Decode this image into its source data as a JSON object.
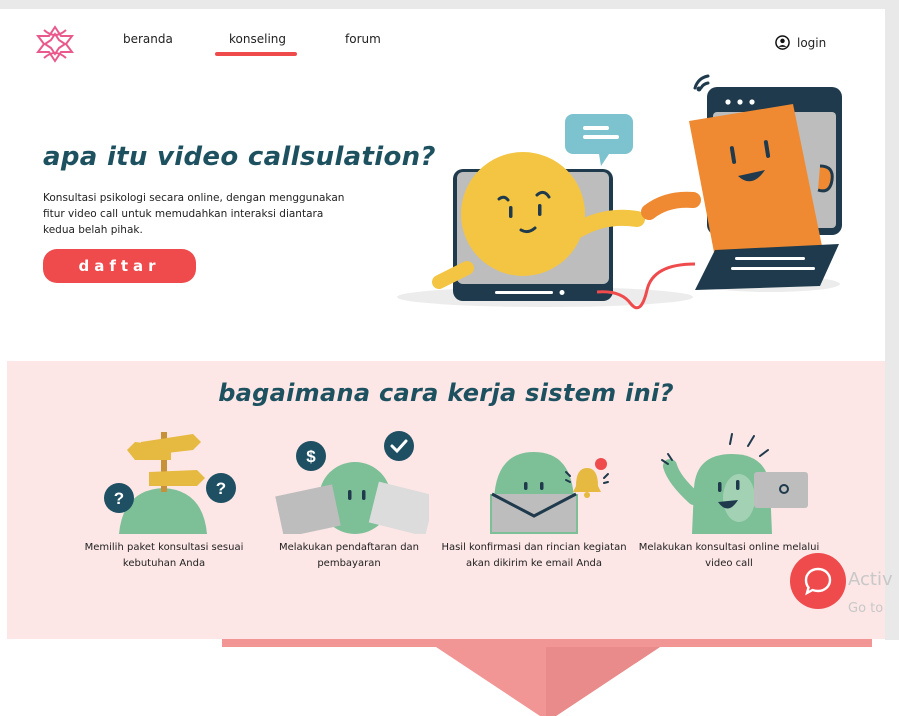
{
  "colors": {
    "brand_red": "#ef4b4d",
    "heading_teal": "#1e5160",
    "section_pink": "#fce6e6",
    "pink_logo": "#e9598c",
    "funnel_pink": "#f29595"
  },
  "header": {
    "logo_icon": "lotus-logo-icon",
    "nav": [
      {
        "label": "beranda"
      },
      {
        "label": "konseling"
      },
      {
        "label": "forum"
      }
    ],
    "active_nav": "konseling",
    "login_icon": "user-circle-icon",
    "login_label": "login"
  },
  "hero": {
    "title": "apa itu video callsulation?",
    "description": "Konsultasi psikologi secara online, dengan menggunakan fitur video call untuk memudahkan interaksi diantara kedua belah pihak.",
    "cta_label": "daftar"
  },
  "how_it_works": {
    "title": "bagaimana cara kerja sistem ini?",
    "steps": [
      {
        "text": "Memilih paket konsultasi sesuai kebutuhan Anda",
        "icon": "signpost-question-icon"
      },
      {
        "text": "Melakukan pendaftaran dan pembayaran",
        "icon": "dollar-check-icon"
      },
      {
        "text": "Hasil konfirmasi dan rincian kegiatan akan dikirim ke email Anda",
        "icon": "email-bell-icon"
      },
      {
        "text": "Melakukan konsultasi online melalui video call",
        "icon": "video-call-icon"
      }
    ]
  },
  "chat_button_icon": "chat-bubble-icon",
  "os_watermark": {
    "line1": "Activ",
    "line2": "Go to"
  }
}
